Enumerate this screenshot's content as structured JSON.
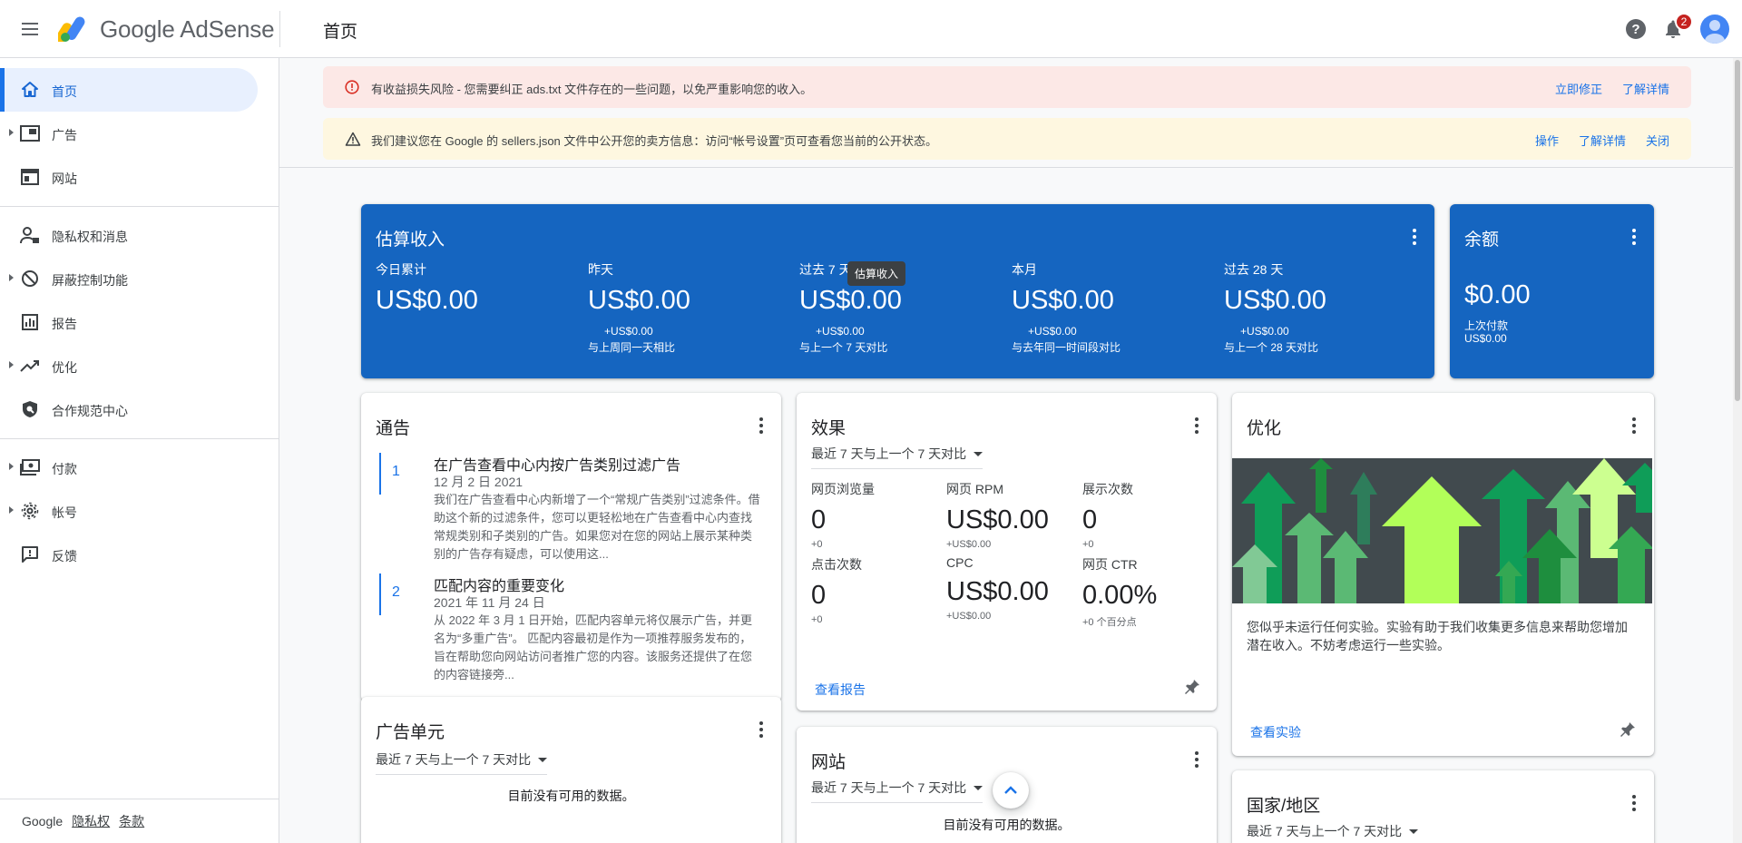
{
  "header": {
    "brand": "Google AdSense",
    "page_title": "首页",
    "notification_count": "2"
  },
  "sidebar": {
    "items": [
      {
        "label": "首页",
        "icon": "home-icon"
      },
      {
        "label": "广告",
        "icon": "ads-icon"
      },
      {
        "label": "网站",
        "icon": "sites-icon"
      },
      {
        "label": "隐私权和消息",
        "icon": "privacy-icon"
      },
      {
        "label": "屏蔽控制功能",
        "icon": "block-icon"
      },
      {
        "label": "报告",
        "icon": "reports-icon"
      },
      {
        "label": "优化",
        "icon": "optimization-icon"
      },
      {
        "label": "合作规范中心",
        "icon": "policy-center-icon"
      },
      {
        "label": "付款",
        "icon": "payments-icon"
      },
      {
        "label": "帐号",
        "icon": "account-icon"
      },
      {
        "label": "反馈",
        "icon": "feedback-icon"
      }
    ],
    "footer": {
      "google": "Google",
      "privacy": "隐私权",
      "terms": "条款"
    }
  },
  "alerts": {
    "error": {
      "text": "有收益损失风险 - 您需要纠正 ads.txt 文件存在的一些问题，以免严重影响您的收入。",
      "action1": "立即修正",
      "action2": "了解详情"
    },
    "warning": {
      "text": "我们建议您在 Google 的 sellers.json 文件中公开您的卖方信息：访问“帐号设置”页可查看您当前的公开状态。",
      "action1": "操作",
      "action2": "了解详情",
      "action3": "关闭"
    }
  },
  "earnings": {
    "title": "估算收入",
    "tooltip": "估算收入",
    "metrics": [
      {
        "label": "今日累计",
        "value": "US$0.00",
        "delta": "",
        "compare": ""
      },
      {
        "label": "昨天",
        "value": "US$0.00",
        "delta": "+US$0.00",
        "compare": "与上周同一天相比"
      },
      {
        "label": "过去 7 天",
        "value": "US$0.00",
        "delta": "+US$0.00",
        "compare": "与上一个 7 天对比"
      },
      {
        "label": "本月",
        "value": "US$0.00",
        "delta": "+US$0.00",
        "compare": "与去年同一时间段对比"
      },
      {
        "label": "过去 28 天",
        "value": "US$0.00",
        "delta": "+US$0.00",
        "compare": "与上一个 28 天对比"
      }
    ]
  },
  "balance": {
    "title": "余额",
    "value": "$0.00",
    "last_payment_label": "上次付款",
    "last_payment_value": "US$0.00"
  },
  "notices": {
    "title": "通告",
    "items": [
      {
        "num": "1",
        "title": "在广告查看中心内按广告类别过滤广告",
        "date": "12 月 2 日 2021",
        "body": "我们在广告查看中心内新增了一个“常规广告类别”过滤条件。借助这个新的过滤条件，您可以更轻松地在广告查看中心内查找常规类别和子类别的广告。如果您对在您的网站上展示某种类别的广告存有疑虑，可以使用这..."
      },
      {
        "num": "2",
        "title": "匹配内容的重要变化",
        "date": "2021 年 11 月 24 日",
        "body": "从 2022 年 3 月 1 日开始，匹配内容单元将仅展示广告，并更名为“多重广告”。 匹配内容最初是作为一项推荐服务发布的，旨在帮助您向网站访问者推广您的内容。该服务还提供了在您的内容链接旁..."
      }
    ]
  },
  "performance": {
    "title": "效果",
    "range": "最近 7 天与上一个 7 天对比",
    "metrics": [
      {
        "label": "网页浏览量",
        "value": "0",
        "delta": "+0"
      },
      {
        "label": "网页 RPM",
        "value": "US$0.00",
        "delta": "+US$0.00"
      },
      {
        "label": "展示次数",
        "value": "0",
        "delta": "+0"
      },
      {
        "label": "点击次数",
        "value": "0",
        "delta": "+0"
      },
      {
        "label": "CPC",
        "value": "US$0.00",
        "delta": "+US$0.00"
      },
      {
        "label": "网页 CTR",
        "value": "0.00%",
        "delta": "+0 个百分点"
      }
    ],
    "link": "查看报告"
  },
  "optimization": {
    "title": "优化",
    "text": "您似乎未运行任何实验。实验有助于我们收集更多信息来帮助您增加潜在收入。不妨考虑运行一些实验。",
    "link": "查看实验"
  },
  "ad_units": {
    "title": "广告单元",
    "range": "最近 7 天与上一个 7 天对比",
    "empty": "目前没有可用的数据。"
  },
  "sites": {
    "title": "网站",
    "range": "最近 7 天与上一个 7 天对比",
    "empty": "目前没有可用的数据。"
  },
  "countries": {
    "title": "国家/地区",
    "range": "最近 7 天与上一个 7 天对比"
  },
  "colors": {
    "primary": "#1a73e8",
    "earnings_card": "#1565c0",
    "error_bg": "#fce8e6",
    "warning_bg": "#fef7e0",
    "error_icon": "#d93025"
  }
}
